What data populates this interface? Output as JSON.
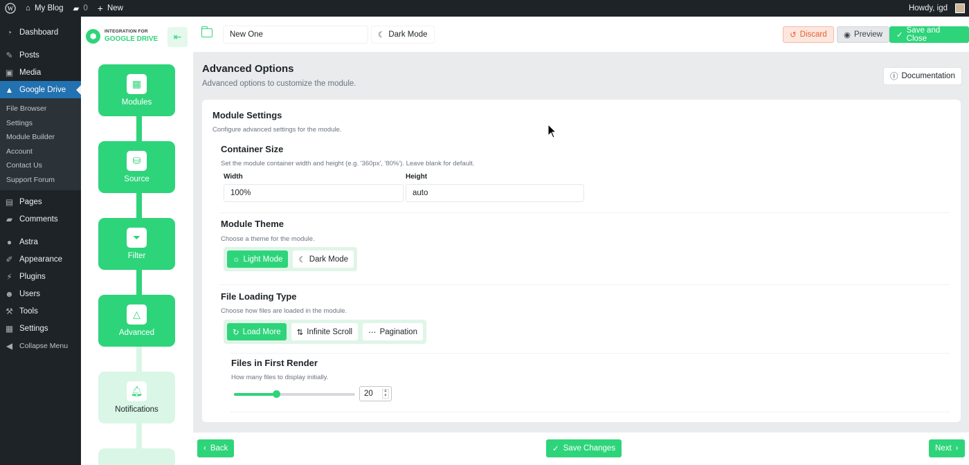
{
  "adminbar": {
    "site_name": "My Blog",
    "comments_count": "0",
    "new_label": "New",
    "howdy": "Howdy, igd"
  },
  "sidebar": {
    "items_top": [
      {
        "label": "Dashboard",
        "icon": "dashboard-icon"
      },
      {
        "label": "Posts",
        "icon": "pin-icon"
      },
      {
        "label": "Media",
        "icon": "media-icon"
      },
      {
        "label": "Google Drive",
        "icon": "google-drive-icon",
        "active": true
      }
    ],
    "submenu": [
      "File Browser",
      "Settings",
      "Module Builder",
      "Account",
      "Contact Us",
      "Support Forum"
    ],
    "items_bottom": [
      {
        "label": "Pages",
        "icon": "pages-icon"
      },
      {
        "label": "Comments",
        "icon": "comment-icon"
      },
      {
        "label": "Astra",
        "icon": "astra-icon"
      },
      {
        "label": "Appearance",
        "icon": "brush-icon"
      },
      {
        "label": "Plugins",
        "icon": "plugin-icon"
      },
      {
        "label": "Users",
        "icon": "user-icon"
      },
      {
        "label": "Tools",
        "icon": "wrench-icon"
      },
      {
        "label": "Settings",
        "icon": "settings-icon"
      },
      {
        "label": "Collapse Menu",
        "icon": "collapse-icon"
      }
    ]
  },
  "topbar": {
    "logo_line1": "INTEGRATION FOR",
    "logo_line2": "GOOGLE DRIVE",
    "module_name": "New One",
    "dark_mode_label": "Dark Mode",
    "discard_label": "Discard",
    "preview_label": "Preview",
    "save_close_label": "Save and Close"
  },
  "steps": [
    {
      "label": "Modules",
      "icon": "grid-icon"
    },
    {
      "label": "Source",
      "icon": "database-search-icon"
    },
    {
      "label": "Filter",
      "icon": "filter-icon"
    },
    {
      "label": "Advanced",
      "icon": "shapes-search-icon"
    },
    {
      "label": "Notifications",
      "icon": "bell-icon"
    }
  ],
  "content": {
    "title": "Advanced Options",
    "subtitle": "Advanced options to customize the module.",
    "documentation_label": "Documentation",
    "module_settings_title": "Module Settings",
    "module_settings_sub": "Configure advanced settings for the module.",
    "container_size": {
      "title": "Container Size",
      "sub": "Set the module container width and height (e.g. '360px', '80%'). Leave blank for default.",
      "width_label": "Width",
      "width_value": "100%",
      "height_label": "Height",
      "height_value": "auto"
    },
    "module_theme": {
      "title": "Module Theme",
      "sub": "Choose a theme for the module.",
      "options": [
        {
          "label": "Light Mode",
          "icon": "sun-icon",
          "active": true
        },
        {
          "label": "Dark Mode",
          "icon": "moon-icon",
          "active": false
        }
      ]
    },
    "file_loading": {
      "title": "File Loading Type",
      "sub": "Choose how files are loaded in the module.",
      "options": [
        {
          "label": "Load More",
          "icon": "refresh-icon",
          "active": true
        },
        {
          "label": "Infinite Scroll",
          "icon": "arrows-icon",
          "active": false
        },
        {
          "label": "Pagination",
          "icon": "dots-icon",
          "active": false
        }
      ]
    },
    "first_render": {
      "title": "Files in First Render",
      "sub": "How many files to display initially.",
      "value": "20",
      "slider_fraction": 0.35
    }
  },
  "footer": {
    "back_label": "Back",
    "save_changes_label": "Save Changes",
    "next_label": "Next"
  },
  "colors": {
    "accent": "#2ed47a",
    "wp_dark": "#1d2327",
    "wp_blue": "#2271b1",
    "discard": "#e3612f"
  }
}
